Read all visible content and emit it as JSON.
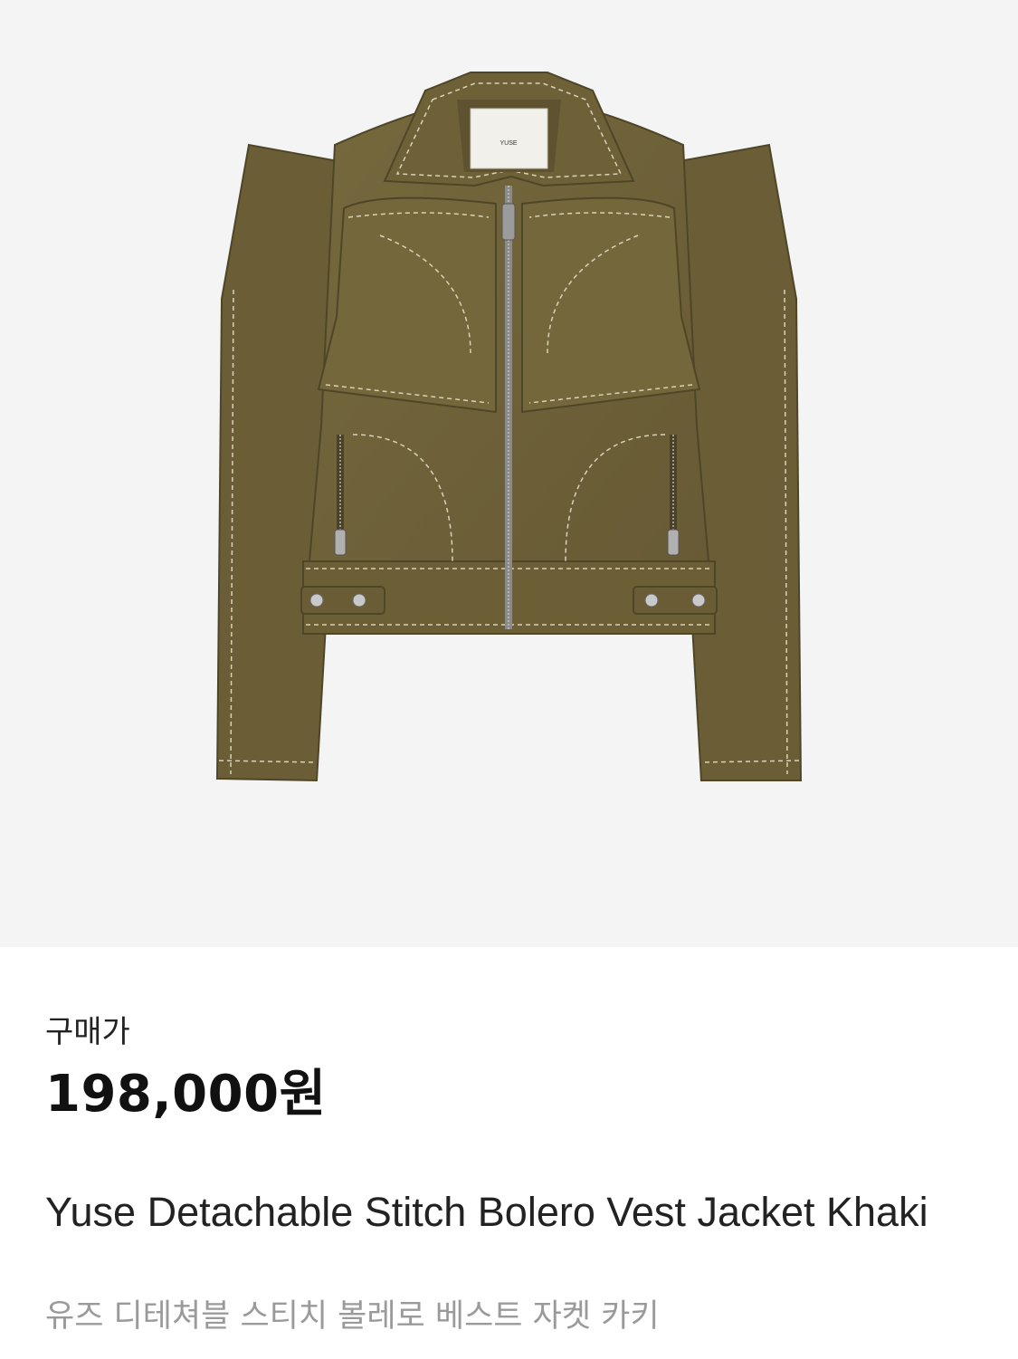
{
  "product": {
    "image": {
      "alt": "Yuse Detachable Stitch Bolero Vest Jacket Khaki",
      "background_color": "#f4f4f4",
      "garment_color": "#6f6238",
      "stitch_color": "#d9d2b8",
      "label_text": "YUSE"
    },
    "price_label": "구매가",
    "price": "198,000원",
    "title_en": "Yuse Detachable Stitch Bolero Vest Jacket Khaki",
    "title_ko": "유즈 디테쳐블 스티치 볼레로 베스트 자켓 카키"
  }
}
